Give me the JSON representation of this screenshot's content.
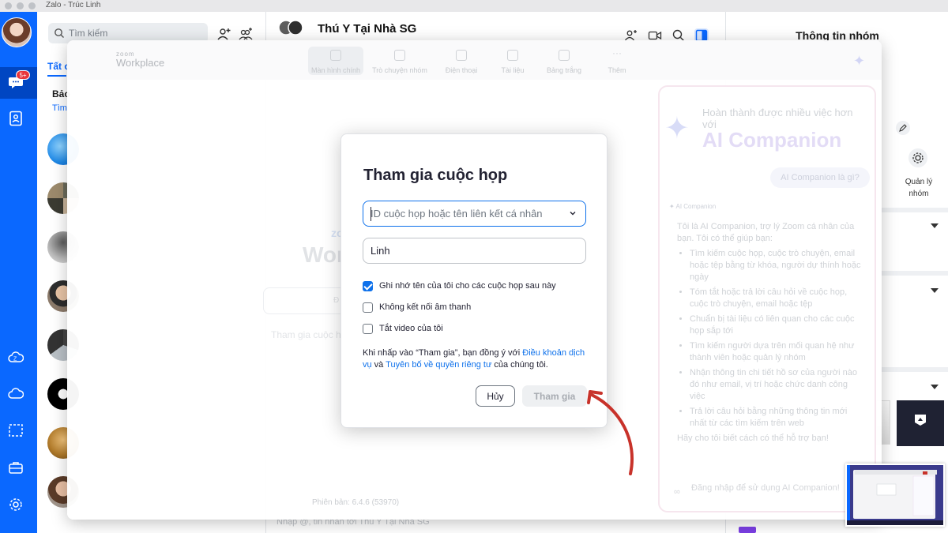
{
  "window": {
    "title": "Zalo - Trúc Linh"
  },
  "rail": {
    "badge": "5+"
  },
  "conv_list": {
    "search_placeholder": "Tìm kiếm",
    "tab_all": "Tất c",
    "header": "Bảo",
    "sub": "Tìm"
  },
  "chat": {
    "group_name": "Thú Y Tại Nhà SG",
    "composer_placeholder": "Nhập @, tin nhắn tới Thú Y Tại Nhà SG"
  },
  "info_panel": {
    "title": "Thông tin nhóm",
    "manage_label": "Quản lý nhóm"
  },
  "zoom": {
    "logo_small": "zoom",
    "logo_large": "Workplace",
    "tabs": [
      "Màn hình chính",
      "Trò chuyện nhóm",
      "Điện thoại",
      "Tài liệu",
      "Bảng trắng",
      "Thêm"
    ],
    "bg_zoom": "zoom",
    "bg_title": "Workplace",
    "bg_input_letter": "Đ",
    "bg_join": "Tham gia cuộc họp",
    "version": "Phiên bản: 6.4.6 (53970)"
  },
  "ai_companion": {
    "tagline": "Hoàn thành được nhiều việc hơn với",
    "brand": "AI Companion",
    "chip": "AI Companion là gì?",
    "small_label": "AI Companion",
    "intro": "Tôi là AI Companion, trợ lý Zoom cá nhân của bạn. Tôi có thể giúp bạn:",
    "items": [
      "Tìm kiếm cuộc họp, cuộc trò chuyện, email hoặc tệp bằng từ khóa, người dự thính hoặc ngày",
      "Tóm tắt hoặc trả lời câu hỏi về cuộc họp, cuộc trò chuyện, email hoặc tệp",
      "Chuẩn bị tài liệu có liên quan cho các cuộc họp sắp tới",
      "Tìm kiếm người dựa trên mối quan hệ như thành viên hoặc quản lý nhóm",
      "Nhận thông tin chi tiết hồ sơ của người nào đó như email, vị trí hoặc chức danh công việc",
      "Trả lời câu hỏi bằng những thông tin mới nhất từ các tìm kiếm trên web"
    ],
    "closing": "Hãy cho tôi biết cách có thể hỗ trợ bạn!",
    "signin": "Đăng nhập để sử dụng AI Companion!"
  },
  "dialog": {
    "title": "Tham gia cuộc họp",
    "id_placeholder": "ID cuộc họp hoặc tên liên kết cá nhân",
    "name_value": "Linh",
    "checkboxes": [
      {
        "label": "Ghi nhớ tên của tôi cho các cuộc họp sau này",
        "checked": true
      },
      {
        "label": "Không kết nối âm thanh",
        "checked": false
      },
      {
        "label": "Tắt video của tôi",
        "checked": false
      }
    ],
    "terms_prefix": "Khi nhấp vào “Tham gia”, bạn đồng ý với ",
    "terms_link": "Điều khoản dịch vụ",
    "terms_and": " và ",
    "privacy_link": "Tuyên bố về quyền riêng tư",
    "terms_suffix": " của chúng tôi.",
    "cancel_label": "Hủy",
    "join_label": "Tham gia"
  },
  "colors": {
    "zalo_blue": "#0a68ff",
    "zoom_blue": "#0e71eb",
    "annotation_red": "#c8322a"
  }
}
